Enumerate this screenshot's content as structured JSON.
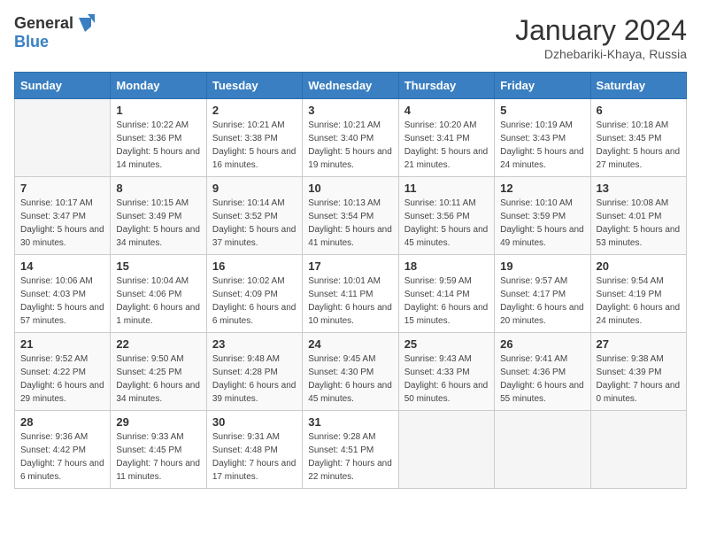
{
  "header": {
    "logo_general": "General",
    "logo_blue": "Blue",
    "month_title": "January 2024",
    "subtitle": "Dzhebariki-Khaya, Russia"
  },
  "weekdays": [
    "Sunday",
    "Monday",
    "Tuesday",
    "Wednesday",
    "Thursday",
    "Friday",
    "Saturday"
  ],
  "weeks": [
    [
      {
        "day": "",
        "sunrise": "",
        "sunset": "",
        "daylight": ""
      },
      {
        "day": "1",
        "sunrise": "Sunrise: 10:22 AM",
        "sunset": "Sunset: 3:36 PM",
        "daylight": "Daylight: 5 hours and 14 minutes."
      },
      {
        "day": "2",
        "sunrise": "Sunrise: 10:21 AM",
        "sunset": "Sunset: 3:38 PM",
        "daylight": "Daylight: 5 hours and 16 minutes."
      },
      {
        "day": "3",
        "sunrise": "Sunrise: 10:21 AM",
        "sunset": "Sunset: 3:40 PM",
        "daylight": "Daylight: 5 hours and 19 minutes."
      },
      {
        "day": "4",
        "sunrise": "Sunrise: 10:20 AM",
        "sunset": "Sunset: 3:41 PM",
        "daylight": "Daylight: 5 hours and 21 minutes."
      },
      {
        "day": "5",
        "sunrise": "Sunrise: 10:19 AM",
        "sunset": "Sunset: 3:43 PM",
        "daylight": "Daylight: 5 hours and 24 minutes."
      },
      {
        "day": "6",
        "sunrise": "Sunrise: 10:18 AM",
        "sunset": "Sunset: 3:45 PM",
        "daylight": "Daylight: 5 hours and 27 minutes."
      }
    ],
    [
      {
        "day": "7",
        "sunrise": "Sunrise: 10:17 AM",
        "sunset": "Sunset: 3:47 PM",
        "daylight": "Daylight: 5 hours and 30 minutes."
      },
      {
        "day": "8",
        "sunrise": "Sunrise: 10:15 AM",
        "sunset": "Sunset: 3:49 PM",
        "daylight": "Daylight: 5 hours and 34 minutes."
      },
      {
        "day": "9",
        "sunrise": "Sunrise: 10:14 AM",
        "sunset": "Sunset: 3:52 PM",
        "daylight": "Daylight: 5 hours and 37 minutes."
      },
      {
        "day": "10",
        "sunrise": "Sunrise: 10:13 AM",
        "sunset": "Sunset: 3:54 PM",
        "daylight": "Daylight: 5 hours and 41 minutes."
      },
      {
        "day": "11",
        "sunrise": "Sunrise: 10:11 AM",
        "sunset": "Sunset: 3:56 PM",
        "daylight": "Daylight: 5 hours and 45 minutes."
      },
      {
        "day": "12",
        "sunrise": "Sunrise: 10:10 AM",
        "sunset": "Sunset: 3:59 PM",
        "daylight": "Daylight: 5 hours and 49 minutes."
      },
      {
        "day": "13",
        "sunrise": "Sunrise: 10:08 AM",
        "sunset": "Sunset: 4:01 PM",
        "daylight": "Daylight: 5 hours and 53 minutes."
      }
    ],
    [
      {
        "day": "14",
        "sunrise": "Sunrise: 10:06 AM",
        "sunset": "Sunset: 4:03 PM",
        "daylight": "Daylight: 5 hours and 57 minutes."
      },
      {
        "day": "15",
        "sunrise": "Sunrise: 10:04 AM",
        "sunset": "Sunset: 4:06 PM",
        "daylight": "Daylight: 6 hours and 1 minute."
      },
      {
        "day": "16",
        "sunrise": "Sunrise: 10:02 AM",
        "sunset": "Sunset: 4:09 PM",
        "daylight": "Daylight: 6 hours and 6 minutes."
      },
      {
        "day": "17",
        "sunrise": "Sunrise: 10:01 AM",
        "sunset": "Sunset: 4:11 PM",
        "daylight": "Daylight: 6 hours and 10 minutes."
      },
      {
        "day": "18",
        "sunrise": "Sunrise: 9:59 AM",
        "sunset": "Sunset: 4:14 PM",
        "daylight": "Daylight: 6 hours and 15 minutes."
      },
      {
        "day": "19",
        "sunrise": "Sunrise: 9:57 AM",
        "sunset": "Sunset: 4:17 PM",
        "daylight": "Daylight: 6 hours and 20 minutes."
      },
      {
        "day": "20",
        "sunrise": "Sunrise: 9:54 AM",
        "sunset": "Sunset: 4:19 PM",
        "daylight": "Daylight: 6 hours and 24 minutes."
      }
    ],
    [
      {
        "day": "21",
        "sunrise": "Sunrise: 9:52 AM",
        "sunset": "Sunset: 4:22 PM",
        "daylight": "Daylight: 6 hours and 29 minutes."
      },
      {
        "day": "22",
        "sunrise": "Sunrise: 9:50 AM",
        "sunset": "Sunset: 4:25 PM",
        "daylight": "Daylight: 6 hours and 34 minutes."
      },
      {
        "day": "23",
        "sunrise": "Sunrise: 9:48 AM",
        "sunset": "Sunset: 4:28 PM",
        "daylight": "Daylight: 6 hours and 39 minutes."
      },
      {
        "day": "24",
        "sunrise": "Sunrise: 9:45 AM",
        "sunset": "Sunset: 4:30 PM",
        "daylight": "Daylight: 6 hours and 45 minutes."
      },
      {
        "day": "25",
        "sunrise": "Sunrise: 9:43 AM",
        "sunset": "Sunset: 4:33 PM",
        "daylight": "Daylight: 6 hours and 50 minutes."
      },
      {
        "day": "26",
        "sunrise": "Sunrise: 9:41 AM",
        "sunset": "Sunset: 4:36 PM",
        "daylight": "Daylight: 6 hours and 55 minutes."
      },
      {
        "day": "27",
        "sunrise": "Sunrise: 9:38 AM",
        "sunset": "Sunset: 4:39 PM",
        "daylight": "Daylight: 7 hours and 0 minutes."
      }
    ],
    [
      {
        "day": "28",
        "sunrise": "Sunrise: 9:36 AM",
        "sunset": "Sunset: 4:42 PM",
        "daylight": "Daylight: 7 hours and 6 minutes."
      },
      {
        "day": "29",
        "sunrise": "Sunrise: 9:33 AM",
        "sunset": "Sunset: 4:45 PM",
        "daylight": "Daylight: 7 hours and 11 minutes."
      },
      {
        "day": "30",
        "sunrise": "Sunrise: 9:31 AM",
        "sunset": "Sunset: 4:48 PM",
        "daylight": "Daylight: 7 hours and 17 minutes."
      },
      {
        "day": "31",
        "sunrise": "Sunrise: 9:28 AM",
        "sunset": "Sunset: 4:51 PM",
        "daylight": "Daylight: 7 hours and 22 minutes."
      },
      {
        "day": "",
        "sunrise": "",
        "sunset": "",
        "daylight": ""
      },
      {
        "day": "",
        "sunrise": "",
        "sunset": "",
        "daylight": ""
      },
      {
        "day": "",
        "sunrise": "",
        "sunset": "",
        "daylight": ""
      }
    ]
  ]
}
